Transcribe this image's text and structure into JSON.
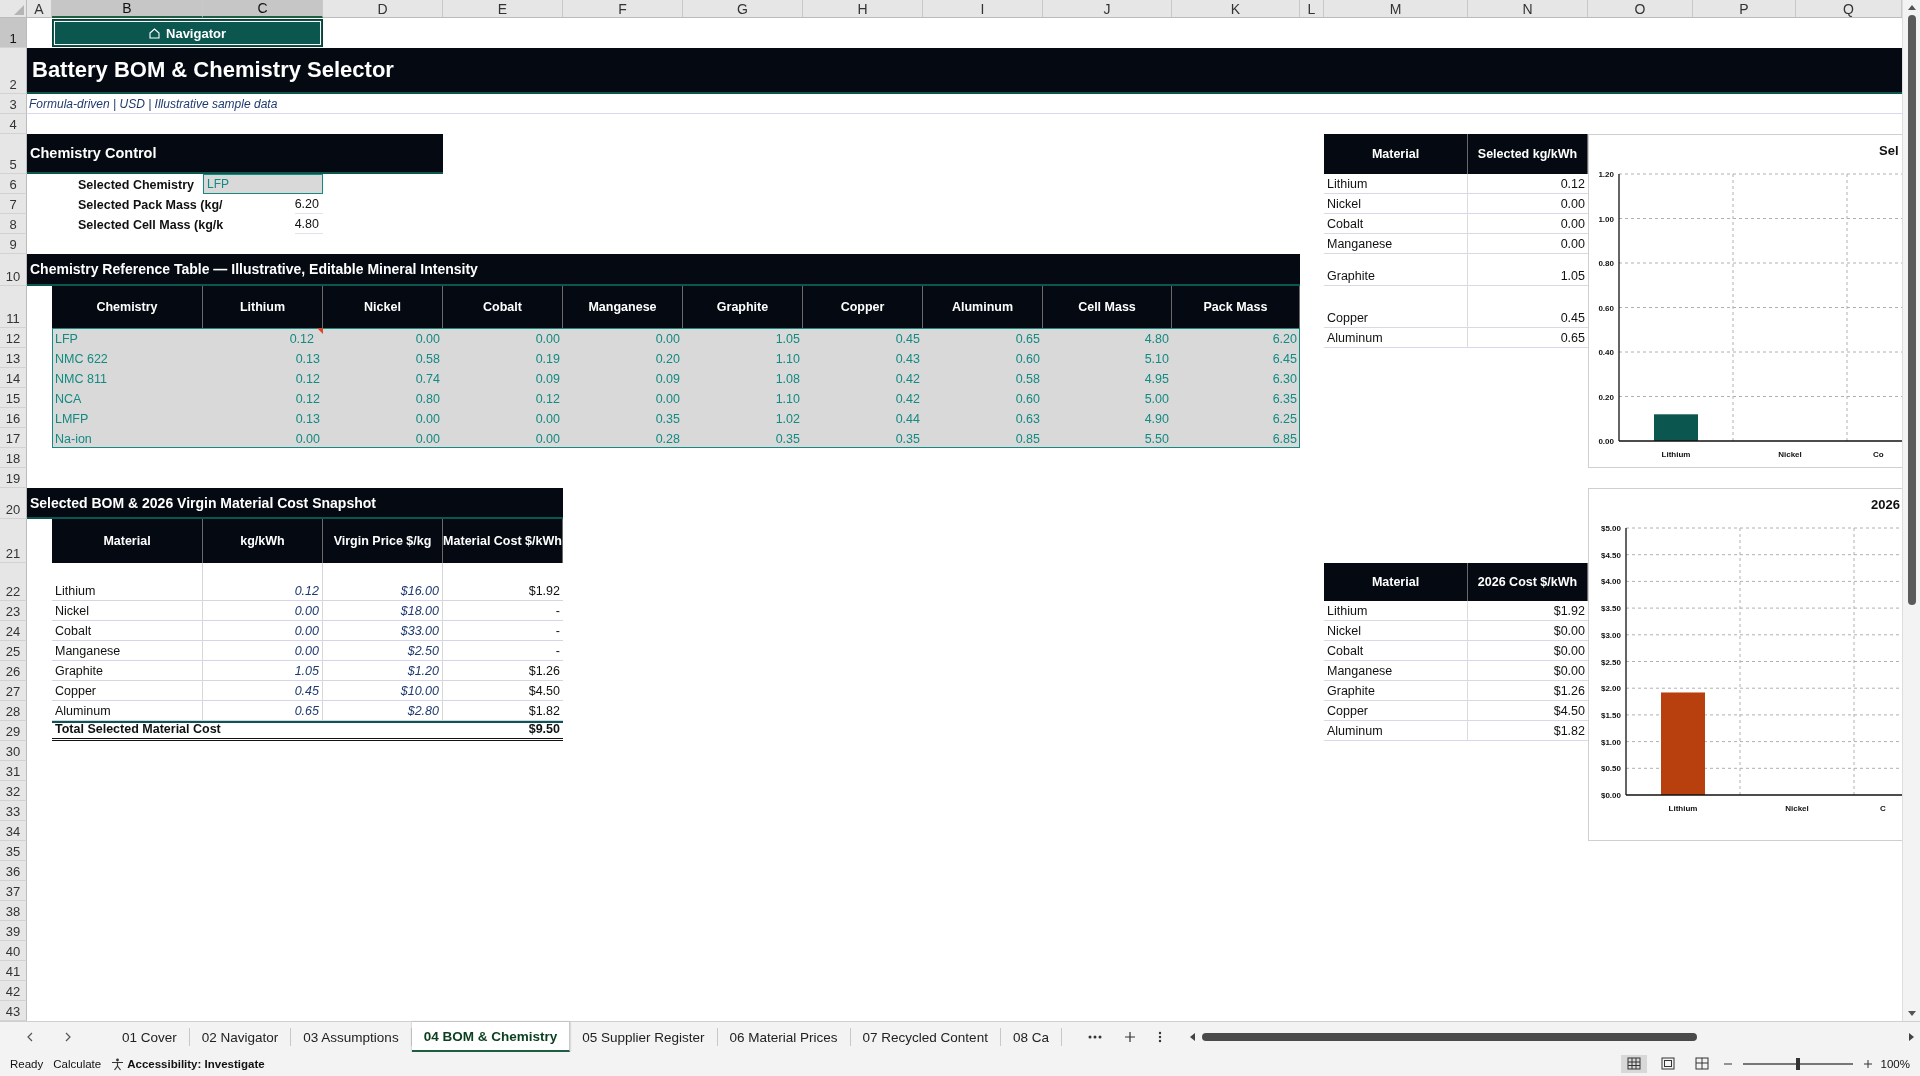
{
  "columns": [
    {
      "label": "A",
      "selected": false
    },
    {
      "label": "B",
      "selected": true
    },
    {
      "label": "C",
      "selected": true
    },
    {
      "label": "D",
      "selected": false
    },
    {
      "label": "E",
      "selected": false
    },
    {
      "label": "F",
      "selected": false
    },
    {
      "label": "G",
      "selected": false
    },
    {
      "label": "H",
      "selected": false
    },
    {
      "label": "I",
      "selected": false
    },
    {
      "label": "J",
      "selected": false
    },
    {
      "label": "K",
      "selected": false
    },
    {
      "label": "L",
      "selected": false
    },
    {
      "label": "M",
      "selected": false
    },
    {
      "label": "N",
      "selected": false
    },
    {
      "label": "O",
      "selected": false
    },
    {
      "label": "P",
      "selected": false
    },
    {
      "label": "Q",
      "selected": false
    }
  ],
  "rows": [
    {
      "label": "1",
      "selected": true
    },
    {
      "label": "2",
      "selected": false
    },
    {
      "label": "3",
      "selected": false
    },
    {
      "label": "4",
      "selected": false
    },
    {
      "label": "5",
      "selected": false
    },
    {
      "label": "6",
      "selected": false
    },
    {
      "label": "7",
      "selected": false
    },
    {
      "label": "8",
      "selected": false
    },
    {
      "label": "9",
      "selected": false
    },
    {
      "label": "10",
      "selected": false
    },
    {
      "label": "11",
      "selected": false
    },
    {
      "label": "12",
      "selected": false
    },
    {
      "label": "13",
      "selected": false
    },
    {
      "label": "14",
      "selected": false
    },
    {
      "label": "15",
      "selected": false
    },
    {
      "label": "16",
      "selected": false
    },
    {
      "label": "17",
      "selected": false
    },
    {
      "label": "18",
      "selected": false
    },
    {
      "label": "19",
      "selected": false
    },
    {
      "label": "20",
      "selected": false
    },
    {
      "label": "21",
      "selected": false
    },
    {
      "label": "22",
      "selected": false
    },
    {
      "label": "23",
      "selected": false
    },
    {
      "label": "24",
      "selected": false
    },
    {
      "label": "25",
      "selected": false
    },
    {
      "label": "26",
      "selected": false
    },
    {
      "label": "27",
      "selected": false
    },
    {
      "label": "28",
      "selected": false
    },
    {
      "label": "29",
      "selected": false
    },
    {
      "label": "30",
      "selected": false
    },
    {
      "label": "31",
      "selected": false
    },
    {
      "label": "32",
      "selected": false
    },
    {
      "label": "33",
      "selected": false
    },
    {
      "label": "34",
      "selected": false
    },
    {
      "label": "35",
      "selected": false
    },
    {
      "label": "36",
      "selected": false
    },
    {
      "label": "37",
      "selected": false
    },
    {
      "label": "38",
      "selected": false
    },
    {
      "label": "39",
      "selected": false
    },
    {
      "label": "40",
      "selected": false
    },
    {
      "label": "41",
      "selected": false
    },
    {
      "label": "42",
      "selected": false
    },
    {
      "label": "43",
      "selected": false
    }
  ],
  "navigator_button": {
    "label": "Navigator"
  },
  "title": "Battery BOM & Chemistry Selector",
  "subtitle": "Formula-driven | USD | Illustrative sample data",
  "chemistry_control": {
    "heading": "Chemistry Control",
    "fields": [
      {
        "label": "Selected Chemistry",
        "value": "LFP",
        "kind": "dropdown"
      },
      {
        "label": "Selected Pack Mass (kg/",
        "value": "6.20",
        "kind": "number"
      },
      {
        "label": "Selected Cell Mass (kg/k",
        "value": "4.80",
        "kind": "number"
      }
    ]
  },
  "reference_table": {
    "heading": "Chemistry Reference Table — Illustrative, Editable Mineral Intensity",
    "columns": [
      "Chemistry",
      "Lithium",
      "Nickel",
      "Cobalt",
      "Manganese",
      "Graphite",
      "Copper",
      "Aluminum",
      "Cell Mass",
      "Pack Mass"
    ],
    "rows": [
      {
        "cells": [
          "LFP",
          "0.12",
          "0.00",
          "0.00",
          "0.00",
          "1.05",
          "0.45",
          "0.65",
          "4.80",
          "6.20"
        ],
        "has_comment": [
          false,
          true,
          false,
          false,
          false,
          false,
          false,
          false,
          false,
          false
        ]
      },
      {
        "cells": [
          "NMC 622",
          "0.13",
          "0.58",
          "0.19",
          "0.20",
          "1.10",
          "0.43",
          "0.60",
          "5.10",
          "6.45"
        ],
        "has_comment": [
          false,
          false,
          false,
          false,
          false,
          false,
          false,
          false,
          false,
          false
        ]
      },
      {
        "cells": [
          "NMC 811",
          "0.12",
          "0.74",
          "0.09",
          "0.09",
          "1.08",
          "0.42",
          "0.58",
          "4.95",
          "6.30"
        ],
        "has_comment": [
          false,
          false,
          false,
          false,
          false,
          false,
          false,
          false,
          false,
          false
        ]
      },
      {
        "cells": [
          "NCA",
          "0.12",
          "0.80",
          "0.12",
          "0.00",
          "1.10",
          "0.42",
          "0.60",
          "5.00",
          "6.35"
        ],
        "has_comment": [
          false,
          false,
          false,
          false,
          false,
          false,
          false,
          false,
          false,
          false
        ]
      },
      {
        "cells": [
          "LMFP",
          "0.13",
          "0.00",
          "0.00",
          "0.35",
          "1.02",
          "0.44",
          "0.63",
          "4.90",
          "6.25"
        ],
        "has_comment": [
          false,
          false,
          false,
          false,
          false,
          false,
          false,
          false,
          false,
          false
        ]
      },
      {
        "cells": [
          "Na-ion",
          "0.00",
          "0.00",
          "0.00",
          "0.28",
          "0.35",
          "0.35",
          "0.85",
          "5.50",
          "6.85"
        ],
        "has_comment": [
          false,
          false,
          false,
          false,
          false,
          false,
          false,
          false,
          false,
          false
        ]
      }
    ]
  },
  "bom_table": {
    "heading": "Selected BOM & 2026 Virgin Material Cost Snapshot",
    "columns": [
      "Material",
      "kg/kWh",
      "Virgin Price $/kg",
      "Material Cost $/kWh"
    ],
    "rows": [
      [
        "Lithium",
        "0.12",
        "$16.00",
        "$1.92"
      ],
      [
        "Nickel",
        "0.00",
        "$18.00",
        "-"
      ],
      [
        "Cobalt",
        "0.00",
        "$33.00",
        "-"
      ],
      [
        "Manganese",
        "0.00",
        "$2.50",
        "-"
      ],
      [
        "Graphite",
        "1.05",
        "$1.20",
        "$1.26"
      ],
      [
        "Copper",
        "0.45",
        "$10.00",
        "$4.50"
      ],
      [
        "Aluminum",
        "0.65",
        "$2.80",
        "$1.82"
      ]
    ],
    "total": {
      "label": "Total Selected Material Cost",
      "value": "$9.50"
    }
  },
  "kg_summary": {
    "columns": [
      "Material",
      "Selected kg/kWh"
    ],
    "rows": [
      [
        "Lithium",
        "0.12"
      ],
      [
        "Nickel",
        "0.00"
      ],
      [
        "Cobalt",
        "0.00"
      ],
      [
        "Manganese",
        "0.00"
      ],
      [
        "Graphite",
        "1.05"
      ],
      [
        "Copper",
        "0.45"
      ],
      [
        "Aluminum",
        "0.65"
      ]
    ]
  },
  "kg_chart": {
    "chart_data": {
      "type": "bar",
      "title": "Sel",
      "categories": [
        "Lithium",
        "Nickel",
        "Co"
      ],
      "grid": true,
      "series": [
        {
          "color": "#0b5750",
          "values": [
            0.12,
            0.0,
            0.0
          ]
        }
      ],
      "ylim": [
        0,
        1.2
      ],
      "yticks": [
        {
          "value": 0,
          "label": "0.00"
        },
        {
          "value": 0.2,
          "label": "0.20"
        },
        {
          "value": 0.4,
          "label": "0.40"
        },
        {
          "value": 0.6,
          "label": "0.60"
        },
        {
          "value": 0.8,
          "label": "0.80"
        },
        {
          "value": 1.0,
          "label": "1.00"
        },
        {
          "value": 1.2,
          "label": "1.20"
        }
      ]
    }
  },
  "cost_summary": {
    "columns": [
      "Material",
      "2026 Cost $/kWh"
    ],
    "rows": [
      [
        "Lithium",
        "$1.92"
      ],
      [
        "Nickel",
        "$0.00"
      ],
      [
        "Cobalt",
        "$0.00"
      ],
      [
        "Manganese",
        "$0.00"
      ],
      [
        "Graphite",
        "$1.26"
      ],
      [
        "Copper",
        "$4.50"
      ],
      [
        "Aluminum",
        "$1.82"
      ]
    ]
  },
  "cost_chart": {
    "chart_data": {
      "type": "bar",
      "title": "2026",
      "categories": [
        "Lithium",
        "Nickel",
        "C"
      ],
      "grid": true,
      "series": [
        {
          "color": "#b8400f",
          "values": [
            1.92,
            0.0,
            0.0
          ]
        }
      ],
      "ylim": [
        0,
        5
      ],
      "yticks": [
        {
          "value": 0,
          "label": "$0.00"
        },
        {
          "value": 0.5,
          "label": "$0.50"
        },
        {
          "value": 1,
          "label": "$1.00"
        },
        {
          "value": 1.5,
          "label": "$1.50"
        },
        {
          "value": 2,
          "label": "$2.00"
        },
        {
          "value": 2.5,
          "label": "$2.50"
        },
        {
          "value": 3,
          "label": "$3.00"
        },
        {
          "value": 3.5,
          "label": "$3.50"
        },
        {
          "value": 4,
          "label": "$4.00"
        },
        {
          "value": 4.5,
          "label": "$4.50"
        },
        {
          "value": 5,
          "label": "$5.00"
        }
      ]
    }
  },
  "sheet_tabs": [
    {
      "label": "01 Cover",
      "selected": false
    },
    {
      "label": "02 Navigator",
      "selected": false
    },
    {
      "label": "03 Assumptions",
      "selected": false
    },
    {
      "label": "04 BOM & Chemistry",
      "selected": true
    },
    {
      "label": "05 Supplier Register",
      "selected": false
    },
    {
      "label": "06 Material Prices",
      "selected": false
    },
    {
      "label": "07 Recycled Content",
      "selected": false
    },
    {
      "label": "08 Ca",
      "selected": false
    }
  ],
  "status_bar": {
    "items": [
      "Ready",
      "Calculate"
    ],
    "accessibility": "Accessibility: Investigate",
    "zoom": "100%",
    "zoom_slider": {
      "level": 0.5
    }
  }
}
